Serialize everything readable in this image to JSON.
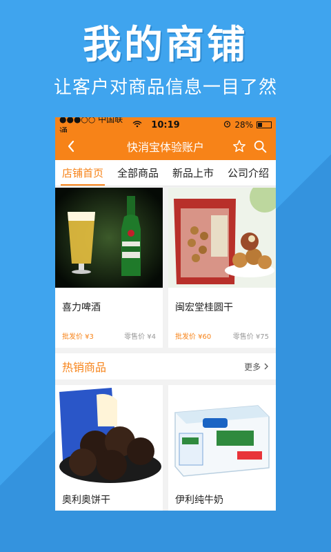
{
  "promo": {
    "headline": "我的商铺",
    "subhead": "让客户对商品信息一目了然"
  },
  "status": {
    "carrier": "●●●○○ 中国联通",
    "time": "10:19",
    "battery": "28%",
    "battery_level": 0.28
  },
  "nav": {
    "title": "快消宝体验账户"
  },
  "tabs": [
    "店铺首页",
    "全部商品",
    "新品上市",
    "公司介绍"
  ],
  "products": [
    {
      "name": "喜力啤酒",
      "wholesale": "批发价 ¥3",
      "retail": "零售价 ¥4"
    },
    {
      "name": "闽宏堂桂圆干",
      "wholesale": "批发价 ¥60",
      "retail": "零售价 ¥75"
    }
  ],
  "hot": {
    "title": "热销商品",
    "more": "更多",
    "items": [
      {
        "name": "奥利奥饼干"
      },
      {
        "name": "伊利纯牛奶"
      }
    ]
  },
  "colors": {
    "accent": "#f78318",
    "background": "#3fa4ee"
  }
}
